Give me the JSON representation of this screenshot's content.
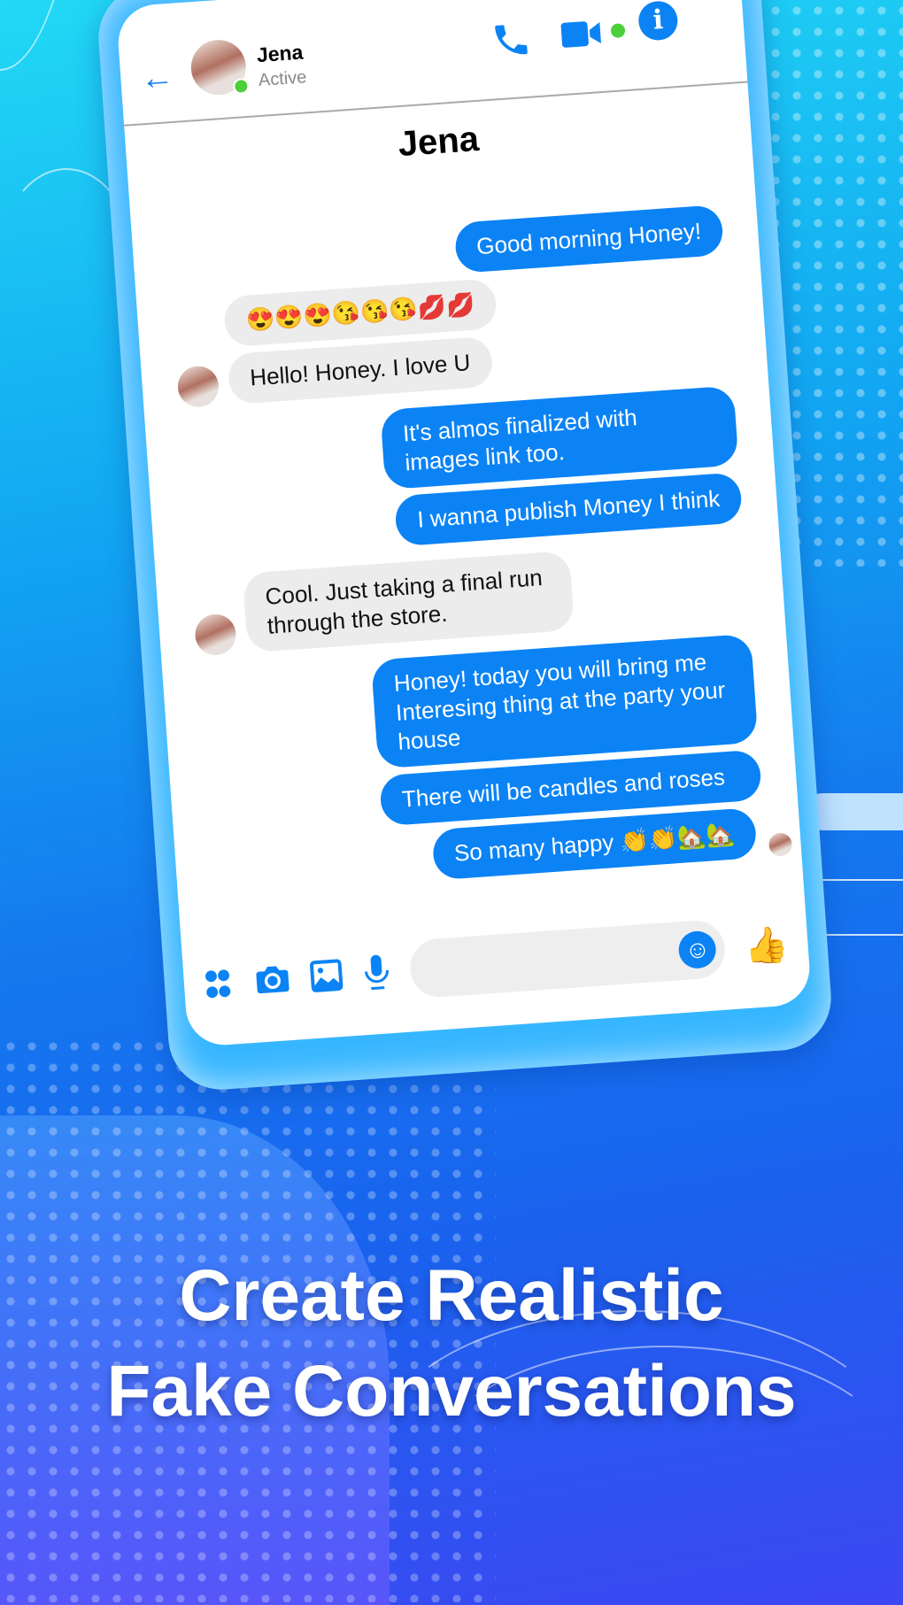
{
  "header": {
    "contact_name": "Jena",
    "status": "Active",
    "icons": [
      "back-arrow-icon",
      "phone-icon",
      "video-icon",
      "info-icon"
    ]
  },
  "chat_title": "Jena",
  "messages": [
    {
      "dir": "out",
      "text": "Good morning Honey!"
    },
    {
      "dir": "in",
      "text": "😍😍😍😘😘😘💋💋"
    },
    {
      "dir": "in",
      "text": "Hello! Honey. I love U",
      "avatar": true
    },
    {
      "dir": "out",
      "text": "It's almos finalized with images link too."
    },
    {
      "dir": "out",
      "text": "I wanna publish Money I think"
    },
    {
      "dir": "in",
      "text": "Cool. Just taking a final run through the store.",
      "avatar": true
    },
    {
      "dir": "out",
      "text": "Honey! today you will bring me Interesing thing at the party your house"
    },
    {
      "dir": "out",
      "text": "There will be candles and roses"
    },
    {
      "dir": "out",
      "text": "So many happy 👏👏🏡🏡",
      "seen": true
    }
  ],
  "composer": {
    "placeholder": "",
    "icons": [
      "apps-icon",
      "camera-icon",
      "gallery-icon",
      "microphone-icon",
      "emoji-icon",
      "thumbs-up-icon"
    ]
  },
  "caption": {
    "line1": "Create Realistic",
    "line2": "Fake Conversations"
  },
  "colors": {
    "accent": "#0b83f5",
    "online": "#4ccf3a"
  }
}
